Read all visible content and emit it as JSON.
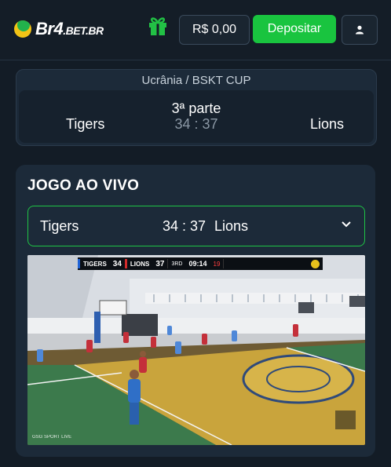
{
  "header": {
    "logo_main": "Br4",
    "logo_suffix": ".BET.BR",
    "balance": "R$ 0,00",
    "deposit_label": "Depositar",
    "gift_icon": "gift-icon",
    "user_icon": "user-icon"
  },
  "match": {
    "league": "Ucrânia / BSKT CUP",
    "period": "3ª parte",
    "home": "Tigers",
    "away": "Lions",
    "score": "34 : 37"
  },
  "live": {
    "title": "JOGO AO VIVO",
    "home": "Tigers",
    "score": "34 : 37",
    "away": "Lions"
  },
  "video": {
    "home_code": "TIGERS",
    "home_score": "34",
    "away_code": "LIONS",
    "away_score": "37",
    "quarter": "3RD",
    "clock": "09:14",
    "shot_clock": "19",
    "watermark": "GSG SPORT LIVE"
  },
  "colors": {
    "accent": "#19c43f",
    "background": "#131c26",
    "card": "#1c2a39"
  }
}
